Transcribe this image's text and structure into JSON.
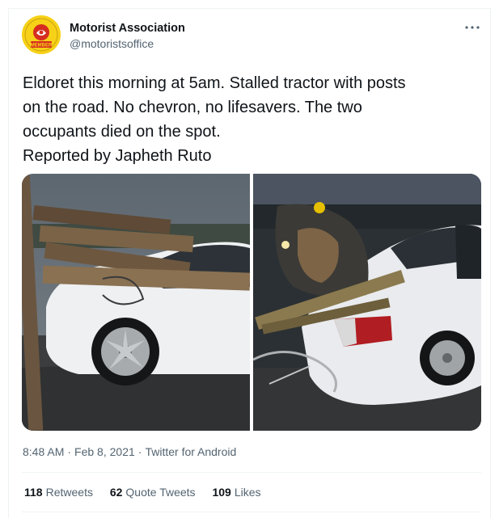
{
  "author": {
    "name": "Motorist Association",
    "handle": "@motoristsoffice",
    "avatar_badge": "MEMBER",
    "avatar_color": "#f7d117"
  },
  "more_icon": "more-horizontal-icon",
  "tweet": {
    "lines": [
      "Eldoret this morning at 5am. Stalled tractor with posts",
      "on the road. No chevron, no lifesavers. The two",
      "occupants died on the spot.",
      "Reported by Japheth Ruto"
    ]
  },
  "media": {
    "photos": [
      "photo-1",
      "photo-2"
    ]
  },
  "meta": {
    "time": "8:48 AM",
    "date": "Feb 8, 2021",
    "client": "Twitter for Android",
    "separator": "·"
  },
  "stats": {
    "retweets_count": "118",
    "retweets_label": "Retweets",
    "quotes_count": "62",
    "quotes_label": "Quote Tweets",
    "likes_count": "109",
    "likes_label": "Likes"
  },
  "colors": {
    "text_primary": "#0f1419",
    "text_secondary": "#536471",
    "divider": "#eff3f4"
  }
}
